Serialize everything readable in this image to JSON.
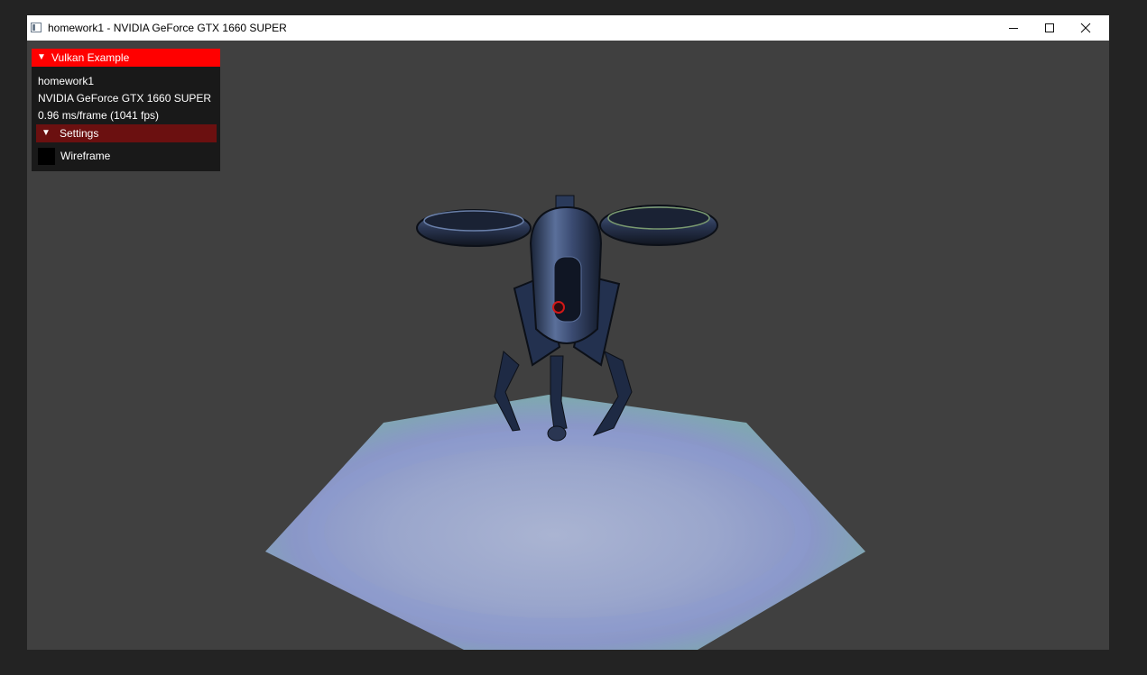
{
  "window": {
    "title": "homework1 - NVIDIA GeForce GTX 1660 SUPER",
    "controls": {
      "minimize_icon": "minimize-icon",
      "maximize_icon": "maximize-icon",
      "close_icon": "close-icon"
    }
  },
  "overlay": {
    "header": "Vulkan Example",
    "app_name": "homework1",
    "device_name": "NVIDIA GeForce GTX 1660 SUPER",
    "frame_stats": "0.96 ms/frame (1041 fps)",
    "settings_header": "Settings",
    "wireframe_label": "Wireframe",
    "wireframe_checked": false
  },
  "scene": {
    "background_color": "#404040",
    "model": "drone-robot",
    "floor": "hexagonal-platform"
  },
  "colors": {
    "header_red": "#ff0000",
    "settings_red": "#6b1010",
    "overlay_bg": "#181818"
  }
}
